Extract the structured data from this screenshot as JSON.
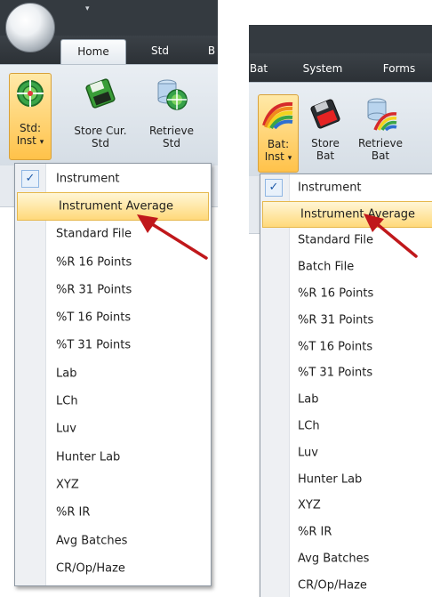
{
  "left": {
    "ribbon_tabs": [
      "Home",
      "Std",
      "B"
    ],
    "buttons": [
      {
        "line1": "Std:",
        "line2": "Inst",
        "dropdown_glyph": "▾",
        "icon": "crosshair-target-icon"
      },
      {
        "line1": "Store Cur.",
        "line2": "Std",
        "icon": "floppy-disk-icon"
      },
      {
        "line1": "Retrieve",
        "line2": "Std",
        "icon": "database-target-icon"
      }
    ],
    "menu": {
      "checked_item": "Instrument",
      "items": [
        "Instrument",
        "Instrument Average",
        "Standard File",
        "%R 16 Points",
        "%R 31 Points",
        "%T 16 Points",
        "%T 31 Points",
        "Lab",
        "LCh",
        "Luv",
        "Hunter Lab",
        "XYZ",
        "%R IR",
        "Avg Batches",
        "CR/Op/Haze"
      ],
      "highlighted_item": "Instrument Average"
    }
  },
  "right": {
    "ribbon_tabs": [
      "Bat",
      "System",
      "Forms"
    ],
    "buttons": [
      {
        "line1": "Bat:",
        "line2": "Inst",
        "dropdown_glyph": "▾",
        "icon": "rainbow-wave-icon"
      },
      {
        "line1": "Store",
        "line2": "Bat",
        "icon": "floppy-disk-red-icon"
      },
      {
        "line1": "Retrieve",
        "line2": "Bat",
        "icon": "database-color-icon"
      }
    ],
    "menu": {
      "checked_item": "Instrument",
      "items": [
        "Instrument",
        "Instrument Average",
        "Standard File",
        "Batch File",
        "%R 16 Points",
        "%R 31 Points",
        "%T 16 Points",
        "%T 31 Points",
        "Lab",
        "LCh",
        "Luv",
        "Hunter Lab",
        "XYZ",
        "%R IR",
        "Avg Batches",
        "CR/Op/Haze"
      ],
      "highlighted_item": "Instrument Average"
    }
  },
  "colors": {
    "accent_highlight": "#ffd97a",
    "annotation_arrow": "#c0181b",
    "ribbon_dark": "#343a40"
  }
}
